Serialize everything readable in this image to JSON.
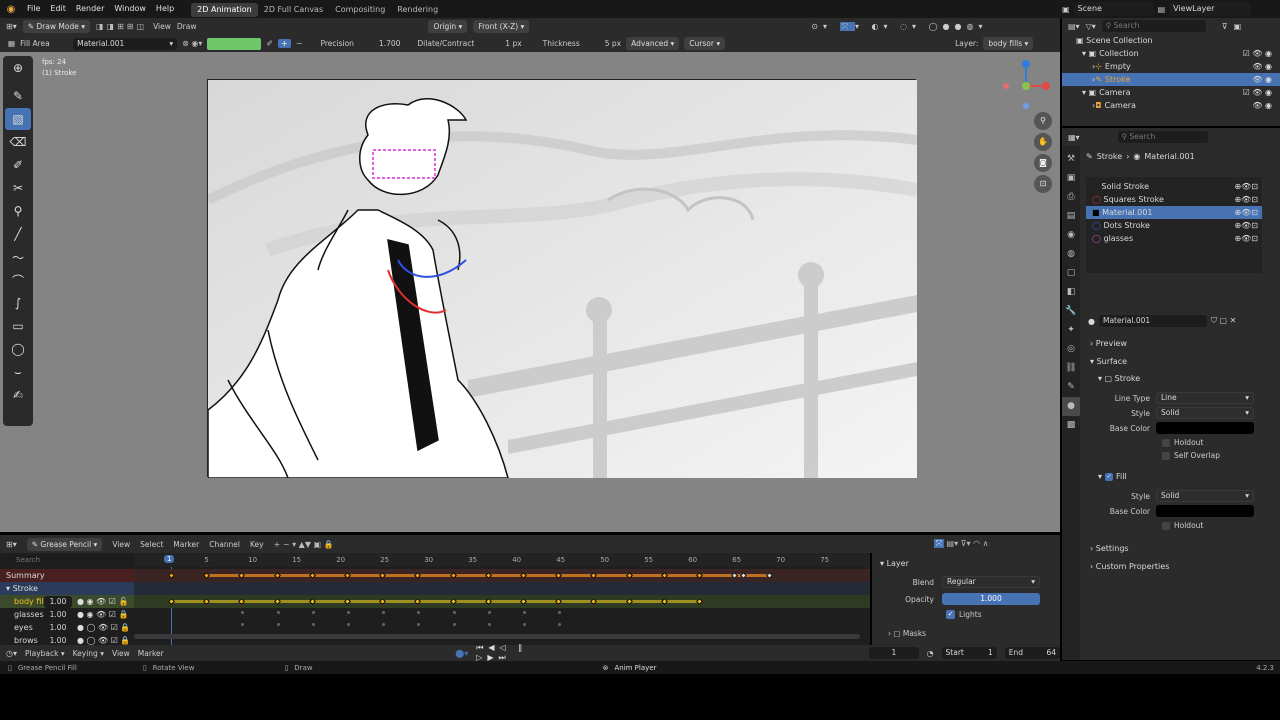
{
  "menu": {
    "items": [
      "File",
      "Edit",
      "Render",
      "Window",
      "Help"
    ]
  },
  "workspaces": [
    "2D Animation",
    "2D Full Canvas",
    "Compositing",
    "Rendering"
  ],
  "scene": "Scene",
  "view_layer": "ViewLayer",
  "header": {
    "mode": "Draw Mode",
    "view": "View",
    "draw": "Draw",
    "origin": "Origin",
    "front": "Front (X-Z)"
  },
  "toolbar": {
    "tool": "Fill Area",
    "material": "Material.001",
    "precision_label": "Precision",
    "precision_value": "1.700",
    "dilate_label": "Dilate/Contract",
    "dilate_value": "1 px",
    "thickness_label": "Thickness",
    "thickness_value": "5 px",
    "advanced": "Advanced",
    "cursor": "Cursor",
    "layer_label": "Layer:",
    "layer_value": "body fills"
  },
  "viewport": {
    "fps": "fps: 24",
    "object": "(1) Stroke"
  },
  "outliner": {
    "search_placeholder": "Search",
    "items": [
      "Scene Collection",
      "Collection",
      "Empty",
      "Stroke",
      "Camera",
      "Camera"
    ]
  },
  "props": {
    "search_placeholder": "Search",
    "breadcrumb_obj": "Stroke",
    "breadcrumb_mat": "Material.001",
    "materials": [
      "Solid Stroke",
      "Squares Stroke",
      "Material.001",
      "Dots Stroke",
      "glasses"
    ],
    "mat_name": "Material.001",
    "preview": "Preview",
    "surface": "Surface",
    "stroke": "Stroke",
    "line_type_label": "Line Type",
    "line_type": "Line",
    "style_label": "Style",
    "style": "Solid",
    "base_color_label": "Base Color",
    "holdout": "Holdout",
    "self_overlap": "Self Overlap",
    "fill": "Fill",
    "fill_style": "Solid",
    "fill_holdout": "Holdout",
    "settings": "Settings",
    "custom_props": "Custom Properties"
  },
  "timeline": {
    "editor": "Grease Pencil",
    "menus": [
      "View",
      "Select",
      "Marker",
      "Channel",
      "Key"
    ],
    "search_placeholder": "Search",
    "current_frame": "1",
    "ticks": [
      "5",
      "10",
      "15",
      "20",
      "25",
      "30",
      "35",
      "40",
      "45",
      "50",
      "55",
      "60",
      "65",
      "70",
      "75"
    ],
    "channels": [
      {
        "name": "Summary"
      },
      {
        "name": "Stroke"
      },
      {
        "name": "body fills",
        "opacity": "1.00"
      },
      {
        "name": "glasses",
        "opacity": "1.00"
      },
      {
        "name": "eyes",
        "opacity": "1.00"
      },
      {
        "name": "brows",
        "opacity": "1.00"
      }
    ]
  },
  "layer_panel": {
    "title": "Layer",
    "blend_label": "Blend",
    "blend": "Regular",
    "opacity_label": "Opacity",
    "opacity": "1.000",
    "lights": "Lights",
    "masks": "Masks"
  },
  "playbar": {
    "playback": "Playback",
    "keying": "Keying",
    "view": "View",
    "marker": "Marker",
    "frame": "1",
    "start_label": "Start",
    "start": "1",
    "end_label": "End",
    "end": "64"
  },
  "status": {
    "left1": "Grease Pencil Fill",
    "left2": "Rotate View",
    "left3": "Draw",
    "center": "Anim Player",
    "version": "4.2.3"
  }
}
